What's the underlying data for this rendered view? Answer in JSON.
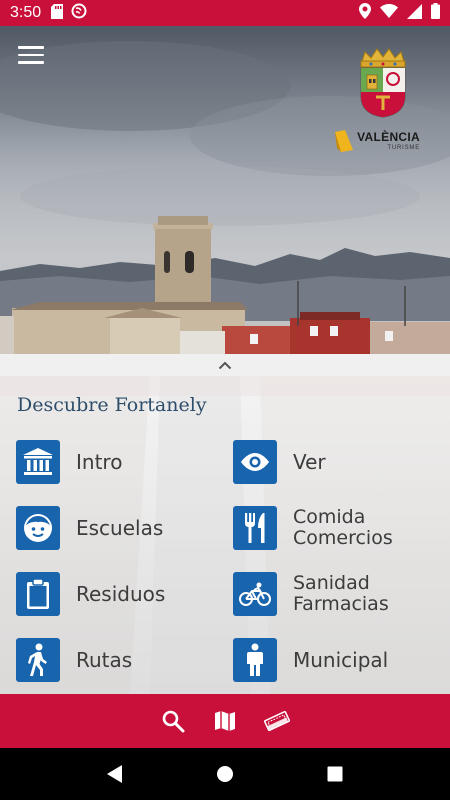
{
  "status_bar": {
    "time": "3:50",
    "left_icons": [
      "sd-card-icon",
      "no-signal-app-icon"
    ],
    "right_icons": [
      "location-icon",
      "wifi-icon",
      "cell-signal-icon",
      "battery-icon"
    ]
  },
  "hero": {
    "menu_icon": "hamburger-menu-icon",
    "logo_brand": "VALÈNCIA",
    "logo_sub": "TURISME"
  },
  "section": {
    "title": "Descubre Fortanely"
  },
  "menu": {
    "intro": {
      "label": "Intro",
      "icon": "museum-icon"
    },
    "ver": {
      "label": "Ver",
      "icon": "eye-icon"
    },
    "escuelas": {
      "label": "Escuelas",
      "icon": "child-face-icon"
    },
    "comida": {
      "line1": "Comida",
      "line2": "Comercios",
      "icon": "fork-knife-icon"
    },
    "residuos": {
      "label": "Residuos",
      "icon": "clipboard-icon"
    },
    "sanidad": {
      "line1": "Sanidad",
      "line2": "Farmacias",
      "icon": "bicycle-icon"
    },
    "rutas": {
      "label": "Rutas",
      "icon": "walking-person-icon"
    },
    "municipal": {
      "label": "Municipal",
      "icon": "person-icon"
    }
  },
  "bottom_bar": {
    "items": [
      "search-icon",
      "map-icon",
      "tickets-icon"
    ]
  },
  "nav_bar": {
    "items": [
      "back-icon",
      "home-icon",
      "recents-icon"
    ]
  },
  "colors": {
    "brand_red": "#c8103a",
    "tile_blue": "#1864ad",
    "title_blue": "#2e4d6b"
  }
}
